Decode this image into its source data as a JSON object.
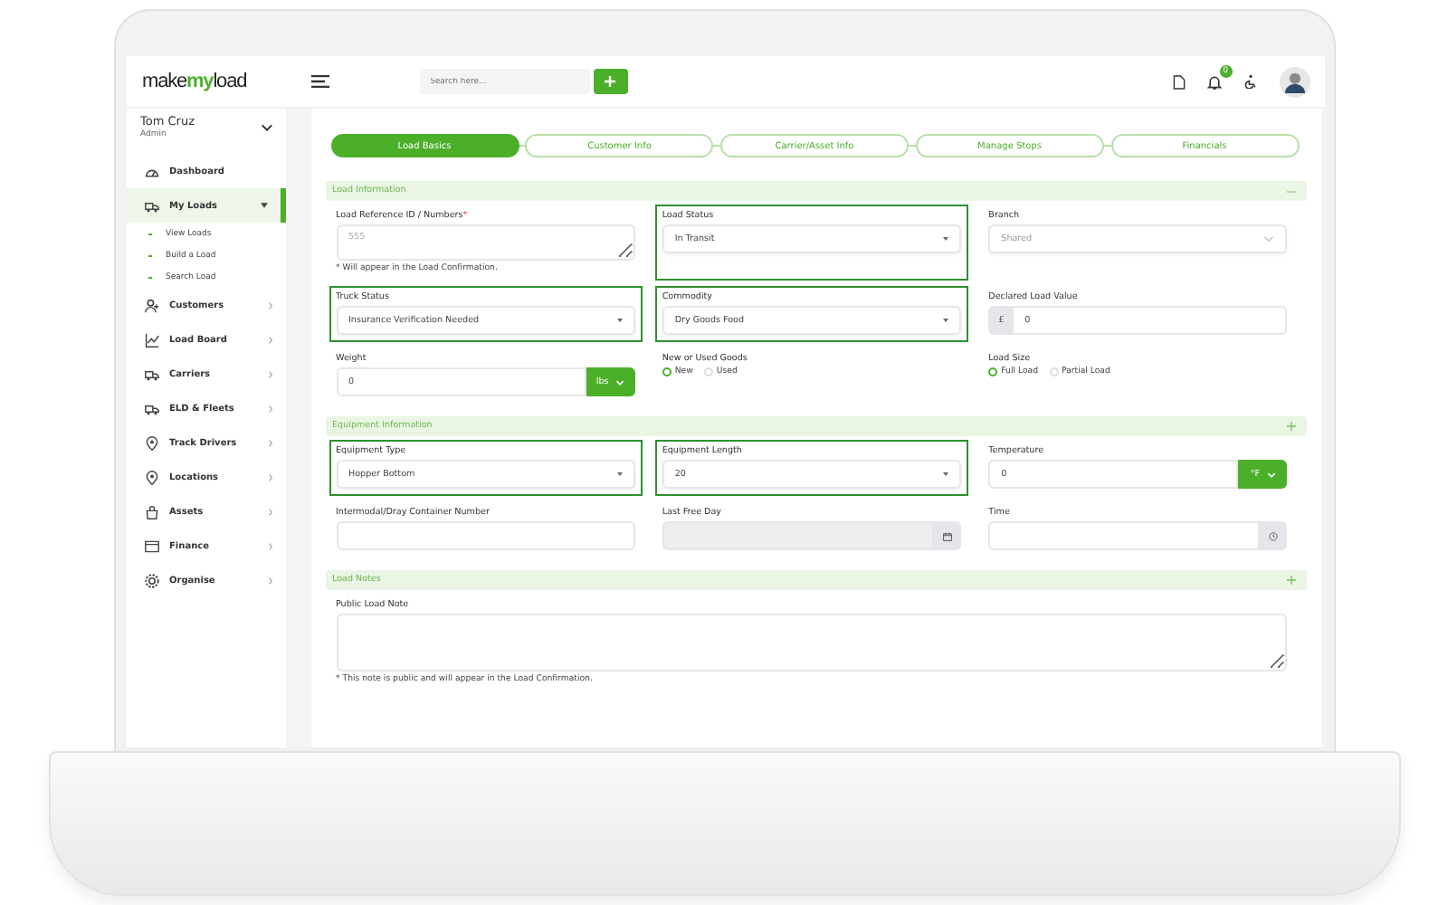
{
  "header": {
    "logo": [
      "make",
      "my",
      "load"
    ],
    "search": {
      "placeholder": "Search here..."
    },
    "notification_count": "0"
  },
  "user": {
    "name": "Tom Cruz",
    "role": "Admin"
  },
  "sidebar": {
    "items": [
      {
        "label": "Dashboard",
        "selected": false,
        "expandable": false
      },
      {
        "label": "My Loads",
        "selected": true,
        "expandable": true,
        "expanded": true,
        "children": [
          {
            "label": "View Loads"
          },
          {
            "label": "Build a Load"
          },
          {
            "label": "Search Load"
          }
        ]
      },
      {
        "label": "Customers",
        "selected": false,
        "expandable": true,
        "expanded": false
      },
      {
        "label": "Load Board",
        "selected": false,
        "expandable": true,
        "expanded": false
      },
      {
        "label": "Carriers",
        "selected": false,
        "expandable": true,
        "expanded": false
      },
      {
        "label": "ELD & Fleets",
        "selected": false,
        "expandable": true,
        "expanded": false
      },
      {
        "label": "Track Drivers",
        "selected": false,
        "expandable": true,
        "expanded": false
      },
      {
        "label": "Locations",
        "selected": false,
        "expandable": true,
        "expanded": false
      },
      {
        "label": "Assets",
        "selected": false,
        "expandable": true,
        "expanded": false
      },
      {
        "label": "Finance",
        "selected": false,
        "expandable": true,
        "expanded": false
      },
      {
        "label": "Organise",
        "selected": false,
        "expandable": true,
        "expanded": false
      }
    ]
  },
  "stepper": [
    {
      "label": "Load Basics",
      "selected": true
    },
    {
      "label": "Customer Info",
      "selected": false
    },
    {
      "label": "Carrier/Asset Info",
      "selected": false
    },
    {
      "label": "Manage Stops",
      "selected": false
    },
    {
      "label": "Financials",
      "selected": false
    }
  ],
  "sections": [
    {
      "title": "Load Information",
      "expanded": true,
      "fields": [
        {
          "kind": "textarea",
          "label": "Load Reference ID / Numbers",
          "required_mark": "*",
          "placeholder": "555",
          "note": "* Will appear in the Load Confirmation.",
          "highlighted": false
        },
        {
          "kind": "select",
          "label": "Load Status",
          "value": "In Transit",
          "highlighted": true,
          "disabled": false
        },
        {
          "kind": "select",
          "label": "Branch",
          "value": "Shared",
          "highlighted": false,
          "disabled": true
        },
        {
          "kind": "select",
          "label": "Truck Status",
          "value": "Insurance Verification Needed",
          "highlighted": true,
          "disabled": false
        },
        {
          "kind": "select",
          "label": "Commodity",
          "value": "Dry Goods Food",
          "highlighted": true,
          "disabled": false
        },
        {
          "kind": "prefix",
          "label": "Declared Load Value",
          "prefix": "£",
          "value": "0",
          "highlighted": false
        },
        {
          "kind": "unit",
          "label": "Weight",
          "value": "0",
          "unit": "lbs",
          "highlighted": false
        },
        {
          "kind": "radio",
          "label": "New or Used Goods",
          "highlighted": false,
          "options": [
            {
              "label": "New",
              "selected": true
            },
            {
              "label": "Used",
              "selected": false
            }
          ]
        },
        {
          "kind": "radio",
          "label": "Load Size",
          "highlighted": false,
          "options": [
            {
              "label": "Full Load",
              "selected": true
            },
            {
              "label": "Partial Load",
              "selected": false
            }
          ]
        }
      ]
    },
    {
      "title": "Equipment Information",
      "expanded": false,
      "fields": [
        {
          "kind": "select",
          "label": "Equipment Type",
          "value": "Hopper Bottom",
          "highlighted": true,
          "disabled": false
        },
        {
          "kind": "select",
          "label": "Equipment Length",
          "value": "20",
          "highlighted": true,
          "disabled": false
        },
        {
          "kind": "unit",
          "label": "Temperature",
          "value": "0",
          "unit": "°F",
          "highlighted": false
        },
        {
          "kind": "text",
          "label": "Intermodal/Dray Container Number",
          "highlighted": false
        },
        {
          "kind": "date",
          "label": "Last Free Day",
          "highlighted": false,
          "disabled": true
        },
        {
          "kind": "time",
          "label": "Time",
          "highlighted": false
        }
      ]
    },
    {
      "title": "Load Notes",
      "expanded": false,
      "fields": [
        {
          "kind": "textarea",
          "label": "Public Load Note",
          "note": "* This note is public and will appear in the Load Confirmation.",
          "highlighted": false,
          "full_width": true
        }
      ]
    }
  ]
}
